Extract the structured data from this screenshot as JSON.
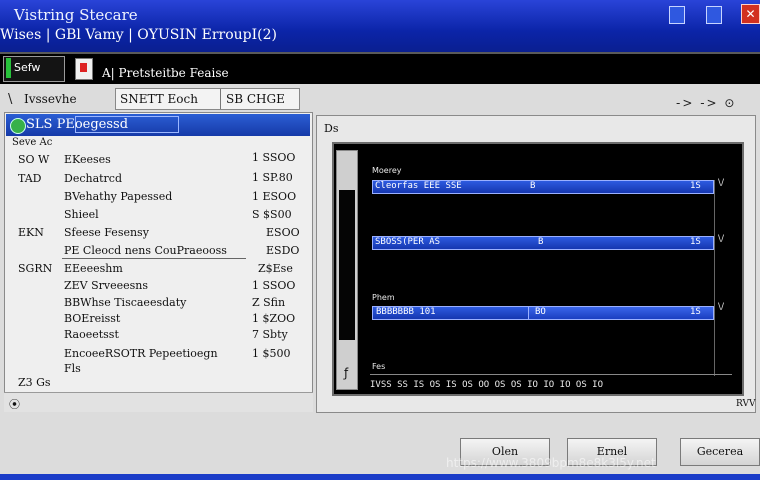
{
  "window": {
    "title": "Vistring Stecare",
    "subtitle": "Wises | GBl Vamy | OYUSIN ErroupI(2)",
    "controls": {
      "minimize": "",
      "maximize": "",
      "close": "✕"
    }
  },
  "toolbar": {
    "logo_label": "Sefw",
    "caption": "A| Pretsteitbe Feaise"
  },
  "address": {
    "back_glyph": "\\",
    "label": "Ivssevhe",
    "field1": "SNETT Eoch",
    "field2": "SB CHGE",
    "nav": "-> -> ⊙"
  },
  "left_panel": {
    "header": "SLS  PEoegessd",
    "subheader": "Seve Ac",
    "rows": [
      {
        "key": "SO W",
        "name": "EKeeses",
        "value": "1 SSOO"
      },
      {
        "key": "TAD",
        "name": "Dechatrcd",
        "value": "1 SP.80"
      },
      {
        "key": "",
        "name": "BVehathy Papessed",
        "value": "1 ESOO"
      },
      {
        "key": "",
        "name": "Shieel",
        "value": "S $S00"
      },
      {
        "key": "EKN",
        "name": "Sfeese Fesensy",
        "value": "ESOO"
      },
      {
        "key": "",
        "name": "PE Cleocd nens CouPraeooss",
        "value": "ESDO"
      },
      {
        "key": "SGRN",
        "name": "EEeeeshm",
        "value": "Z$Ese"
      },
      {
        "key": "",
        "name": "ZEV Srveeesns",
        "value": "1 SSOO"
      },
      {
        "key": "",
        "name": "BBWhse Tiscaeesdaty",
        "value": "Z Sfin"
      },
      {
        "key": "",
        "name": "BOEreisst",
        "value": "1 $ZOO"
      },
      {
        "key": "",
        "name": "Raoeetsst",
        "value": "7 Sbty"
      },
      {
        "key": "",
        "name": "EncoeeRSOTR Pepeetioegn",
        "value": "1 $500"
      },
      {
        "key": "",
        "name": "Fls",
        "value": ""
      }
    ],
    "footer": "Z3 Gs",
    "status_glyph": "⦿"
  },
  "right_panel": {
    "top_label": "Ds",
    "corner_label": "RVV",
    "graph": {
      "label_top": "Moerey",
      "bars": [
        {
          "text": "Cleorfas  EEE SSE",
          "mid": "B",
          "end": "1S"
        },
        {
          "text": "SBOSS(PER AS",
          "mid": "B",
          "end": "1S"
        },
        {
          "text": "BBBBBBB  101",
          "mid": "BO",
          "end": "1S"
        }
      ],
      "label_mid": "Phem",
      "label_bottom": "Fes",
      "axis_ticks": "IVSS  SS  IS  OS  IS  OS  OO  OS  OS  IO  IO  IO  OS  IO",
      "markers": [
        "\\/",
        "\\/",
        "\\/"
      ]
    }
  },
  "buttons": {
    "ok": "Olen",
    "middle": "Ernel",
    "cancel": "Gecerea"
  },
  "watermark": "https://www.3809bpm8e8k3l5y.net"
}
